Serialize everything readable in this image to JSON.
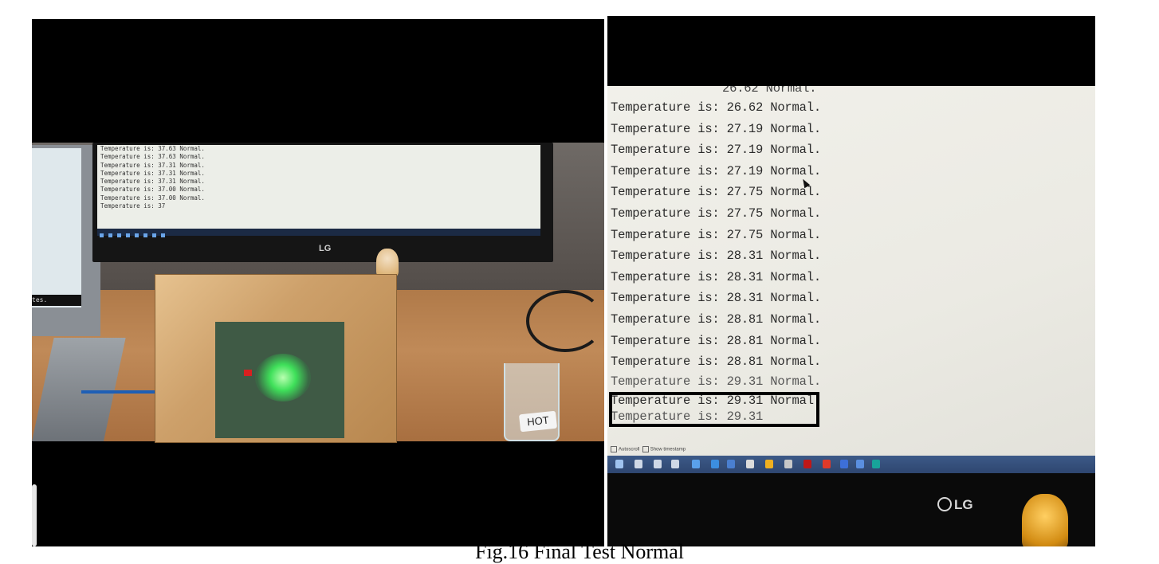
{
  "left_photo": {
    "serial_lines": [
      "Temperature is: 37.63 Normal.",
      "Temperature is: 37.63 Normal.",
      "Temperature is: 37.31 Normal.",
      "Temperature is: 37.31 Normal.",
      "Temperature is: 37.31 Normal.",
      "Temperature is: 37.00 Normal.",
      "Temperature is: 37.00 Normal.",
      "Temperature is: 37"
    ],
    "laptop_console_text": "tes.",
    "monitor_brand": "LG",
    "beaker_label": "HOT"
  },
  "right_photo": {
    "cut_line": "26.62 Normal.",
    "serial_lines": [
      "Temperature is: 26.62 Normal.",
      "Temperature is: 27.19 Normal.",
      "Temperature is: 27.19 Normal.",
      "Temperature is: 27.19 Normal.",
      "Temperature is: 27.75 Normal.",
      "Temperature is: 27.75 Normal.",
      "Temperature is: 27.75 Normal.",
      "Temperature is: 28.31 Normal.",
      "Temperature is: 28.31 Normal.",
      "Temperature is: 28.31 Normal.",
      "Temperature is: 28.81 Normal.",
      "Temperature is: 28.81 Normal.",
      "Temperature is: 28.81 Normal.",
      "Temperature is: 29.31 Normal."
    ],
    "highlighted_line": "Temperature is: 29.31 Normal.",
    "partial_line": "Temperature is: 29.31",
    "footer": {
      "autoscroll_label": "Autoscroll",
      "timestamp_label": "Show timestamp"
    },
    "monitor_brand": "LG",
    "accent_colors": {
      "taskbar": "#2e4670",
      "highlight_box": "#000000"
    }
  },
  "caption": "Fig.16 Final Test Normal"
}
